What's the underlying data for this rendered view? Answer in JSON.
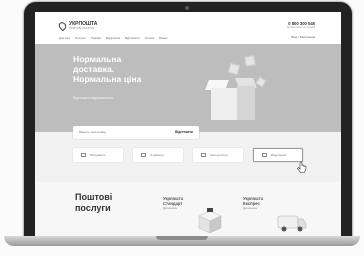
{
  "header": {
    "logo_name": "УКРПОШТА",
    "logo_tagline": "ПОШТОВІ ПОСЛУГИ",
    "phone": "0 800 300 545",
    "phone_caption": "безкоштовно по Україні",
    "nav": [
      "Для кого",
      "Послуги",
      "Тарифи",
      "Відділення",
      "Відстежити",
      "Оплата",
      "Бізнес"
    ],
    "account": "Вхід / Реєстрація"
  },
  "hero": {
    "title_line1": "Нормальна",
    "title_line2": "доставка.",
    "title_line3": "Нормальна ціна",
    "subtitle": "Відстежити відправлення"
  },
  "search": {
    "placeholder": "Введіть трек-номер",
    "button": "Відстежити"
  },
  "services": [
    {
      "label": "Відправити"
    },
    {
      "label": "Отримати"
    },
    {
      "label": "Калькулятор"
    },
    {
      "label": "Відділення"
    }
  ],
  "lower": {
    "title_line1": "Поштові",
    "title_line2": "послуги",
    "products": [
      {
        "name_line1": "Укрпошта",
        "name_line2": "Стандарт",
        "caption": "Детальніше"
      },
      {
        "name_line1": "Укрпошта",
        "name_line2": "Експрес",
        "caption": "Детальніше"
      }
    ]
  }
}
